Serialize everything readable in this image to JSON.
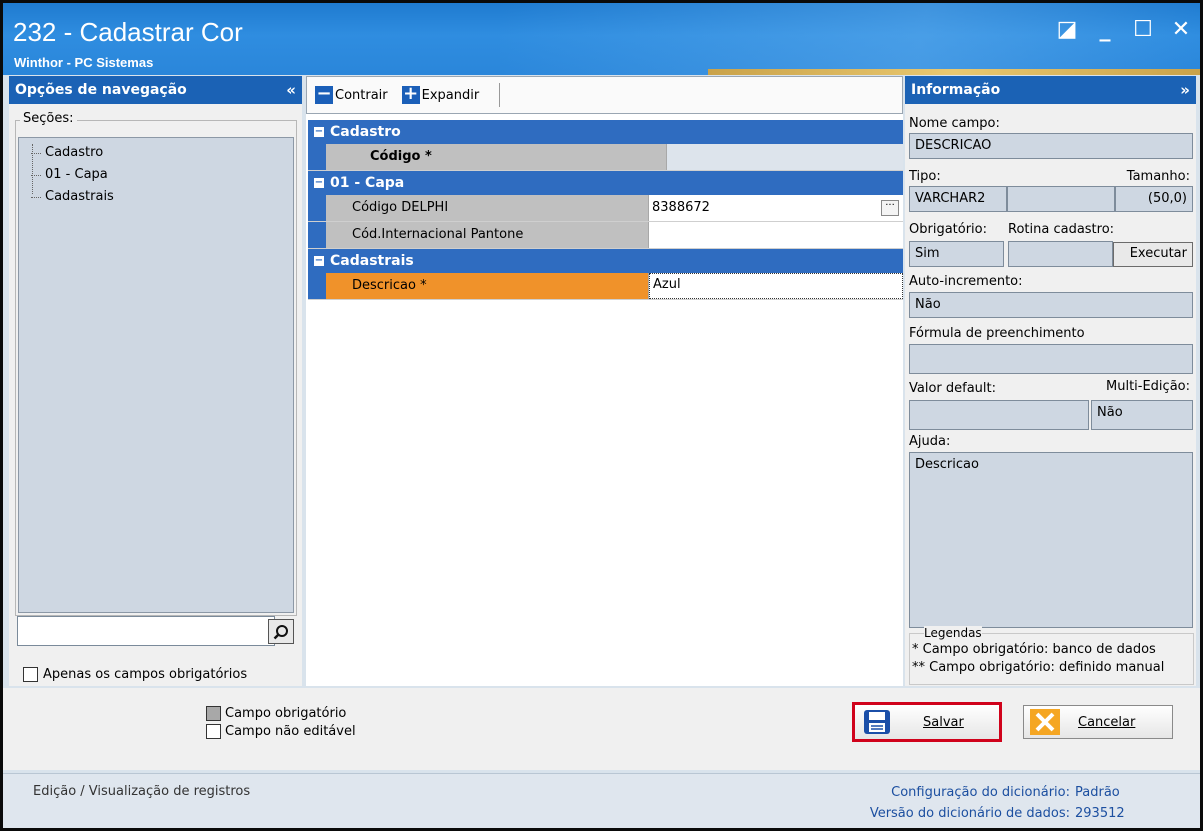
{
  "window": {
    "title": "232 - Cadastrar Cor",
    "subtitle": "Winthor - PC Sistemas",
    "controls": [
      "restore",
      "minimize",
      "maximize",
      "close"
    ]
  },
  "left_panel": {
    "header": "Opções de navegação",
    "sections_label": "Seções:",
    "tree_items": [
      "Cadastro",
      "01 - Capa",
      "Cadastrais"
    ],
    "search_value": "",
    "only_required_label": "Apenas os campos obrigatórios"
  },
  "toolbar": {
    "collapse_label": "Contrair",
    "expand_label": "Expandir"
  },
  "grid": {
    "categories": [
      {
        "name": "Cadastro",
        "rows": [
          {
            "label": "Código *",
            "value": "",
            "readonly": true,
            "bold": true
          }
        ]
      },
      {
        "name": "01 - Capa",
        "rows": [
          {
            "label": "Código DELPHI",
            "value": "8388672",
            "has_ellipsis": true
          },
          {
            "label": "Cód.Internacional Pantone",
            "value": ""
          }
        ]
      },
      {
        "name": "Cadastrais",
        "rows": [
          {
            "label": "Descricao *",
            "value": "Azul",
            "selected": true
          }
        ]
      }
    ]
  },
  "info_panel": {
    "header": "Informação",
    "nome_campo_label": "Nome campo:",
    "nome_campo": "DESCRICAO",
    "tipo_label": "Tipo:",
    "tipo": "VARCHAR2",
    "tamanho_label": "Tamanho:",
    "tamanho": "(50,0)",
    "obrigatorio_label": "Obrigatório:",
    "obrigatorio": "Sim",
    "rotina_label": "Rotina cadastro:",
    "executar_label": "Executar",
    "auto_inc_label": "Auto-incremento:",
    "auto_inc": "Não",
    "formula_label": "Fórmula de preenchimento",
    "formula": "",
    "valor_default_label": "Valor default:",
    "valor_default": "",
    "multi_edicao_label": "Multi-Edição:",
    "multi_edicao": "Não",
    "ajuda_label": "Ajuda:",
    "ajuda": "Descricao",
    "legendas_label": "Legendas",
    "legend1": "* Campo obrigatório: banco de dados",
    "legend2": "** Campo obrigatório: definido manual"
  },
  "bottom": {
    "legend_required": "Campo obrigatório",
    "legend_noneditable": "Campo não editável",
    "save_label": "Salvar",
    "cancel_label": "Cancelar"
  },
  "status": {
    "left": "Edição / Visualização de registros",
    "config_label": "Configuração do dicionário:",
    "config_value": "Padrão",
    "version_label": "Versão do dicionário de dados:",
    "version_value": "293512"
  },
  "colors": {
    "title_blue": "#2a86da",
    "header_blue": "#1b62b5",
    "category_blue": "#2f6cc0",
    "selected_orange": "#f0922a",
    "save_highlight": "#d0021b",
    "cancel_orange": "#f5a623"
  }
}
